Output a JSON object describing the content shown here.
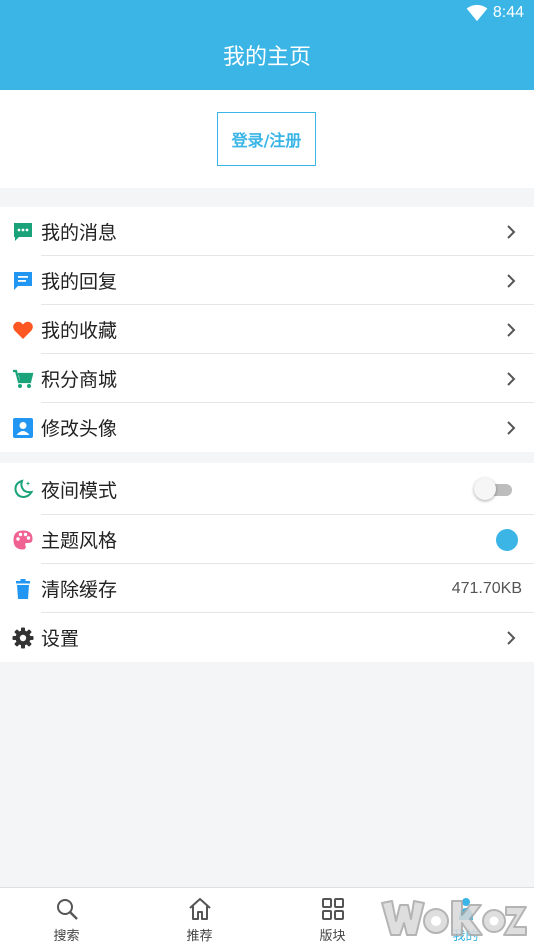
{
  "status_bar": {
    "time": "8:44"
  },
  "header": {
    "title": "我的主页"
  },
  "login": {
    "label": "登录/注册"
  },
  "menu": [
    {
      "label": "我的消息",
      "icon": "message-dots-icon"
    },
    {
      "label": "我的回复",
      "icon": "reply-chat-icon"
    },
    {
      "label": "我的收藏",
      "icon": "heart-icon"
    },
    {
      "label": "积分商城",
      "icon": "cart-icon"
    },
    {
      "label": "修改头像",
      "icon": "portrait-icon"
    }
  ],
  "settings": {
    "night_mode": {
      "label": "夜间模式",
      "enabled": false
    },
    "theme": {
      "label": "主题风格",
      "color": "#3ab5e6"
    },
    "cache": {
      "label": "清除缓存",
      "value": "471.70KB"
    },
    "settings": {
      "label": "设置"
    }
  },
  "tabs": [
    {
      "label": "搜索",
      "icon": "search-icon"
    },
    {
      "label": "推荐",
      "icon": "home-icon"
    },
    {
      "label": "版块",
      "icon": "grid-icon"
    },
    {
      "label": "我的",
      "icon": "person-icon",
      "active": true
    }
  ],
  "colors": {
    "accent": "#3ab5e6",
    "background": "#f4f5f7"
  }
}
